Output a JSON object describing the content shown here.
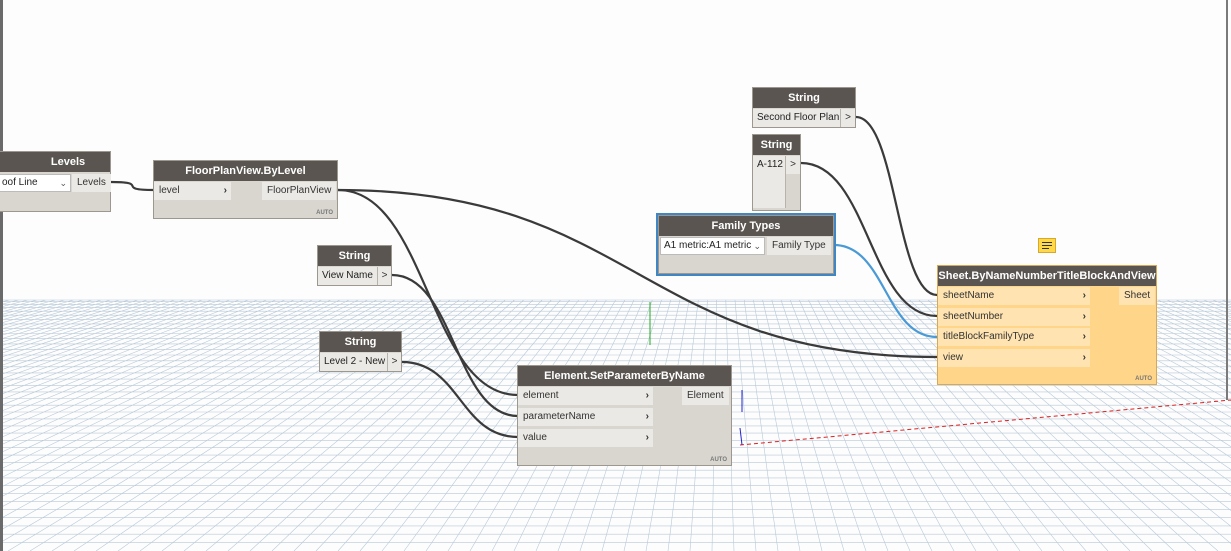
{
  "nodes": {
    "levels": {
      "title": "Levels",
      "selected_value": "oof Line",
      "output": "Levels"
    },
    "floorplan": {
      "title": "FloorPlanView.ByLevel",
      "input": "level",
      "output": "FloorPlanView",
      "lacing": "AUTO"
    },
    "string_viewname": {
      "title": "String",
      "value": "View Name",
      "output_btn": ">"
    },
    "string_level2": {
      "title": "String",
      "value": "Level 2 - New",
      "output_btn": ">"
    },
    "setparam": {
      "title": "Element.SetParameterByName",
      "inputs": [
        "element",
        "parameterName",
        "value"
      ],
      "output": "Element",
      "lacing": "AUTO"
    },
    "family_types": {
      "title": "Family Types",
      "selected_value": "A1 metric:A1 metric",
      "output": "Family Type"
    },
    "string_second": {
      "title": "String",
      "value": "Second Floor Plan",
      "output_btn": ">"
    },
    "string_a112": {
      "title": "String",
      "value": "A-112",
      "output_btn": ">"
    },
    "sheet": {
      "title": "Sheet.ByNameNumberTitleBlockAndView",
      "inputs": [
        "sheetName",
        "sheetNumber",
        "titleBlockFamilyType",
        "view"
      ],
      "output": "Sheet",
      "lacing": "AUTO"
    }
  },
  "colors": {
    "node_header": "#5a5551",
    "node_body": "#d9d6d0",
    "selected_outline": "#3f86c2",
    "sheet_body": "#ffd58a",
    "wire": "#3a3a3a",
    "wire_selected": "#4a9ad6"
  },
  "icons": {
    "comment": "comment-icon",
    "port_arrow": "chevron-right-icon",
    "dropdown": "chevron-down-icon"
  }
}
